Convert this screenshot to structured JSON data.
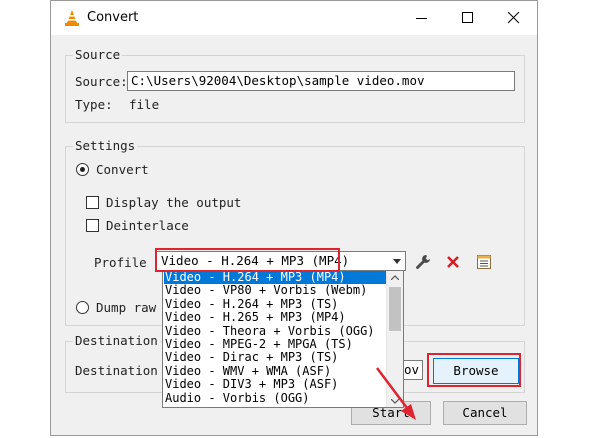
{
  "window": {
    "title": "Convert"
  },
  "source": {
    "legend": "Source",
    "source_label": "Source:",
    "source_value": "C:\\Users\\92004\\Desktop\\sample video.mov",
    "type_label": "Type:",
    "type_value": "file"
  },
  "settings": {
    "legend": "Settings",
    "convert_label": "Convert",
    "display_output_label": "Display the output",
    "deinterlace_label": "Deinterlace",
    "profile_label": "Profile",
    "profile_selected": "Video - H.264 + MP3 (MP4)",
    "dump_raw_label": "Dump raw s",
    "profile_options": [
      "Video - H.264 + MP3 (MP4)",
      "Video - VP80 + Vorbis (Webm)",
      "Video - H.264 + MP3 (TS)",
      "Video - H.265 + MP3 (MP4)",
      "Video - Theora + Vorbis (OGG)",
      "Video - MPEG-2 + MPGA (TS)",
      "Video - Dirac + MP3 (TS)",
      "Video - WMV + WMA (ASF)",
      "Video - DIV3 + MP3 (ASF)",
      "Audio - Vorbis (OGG)"
    ]
  },
  "destination": {
    "legend": "Destination",
    "file_label": "Destination f",
    "file_value": "mov",
    "browse_label": "Browse"
  },
  "buttons": {
    "start": "Start",
    "cancel": "Cancel"
  },
  "colors": {
    "highlight": "#e0242f",
    "selection": "#0078d7",
    "accent_orange": "#f08a00"
  },
  "icons": {
    "app": "vlc-cone-icon",
    "edit_profile": "wrench-icon",
    "delete_profile": "red-x-icon",
    "new_profile": "list-sheet-icon"
  }
}
